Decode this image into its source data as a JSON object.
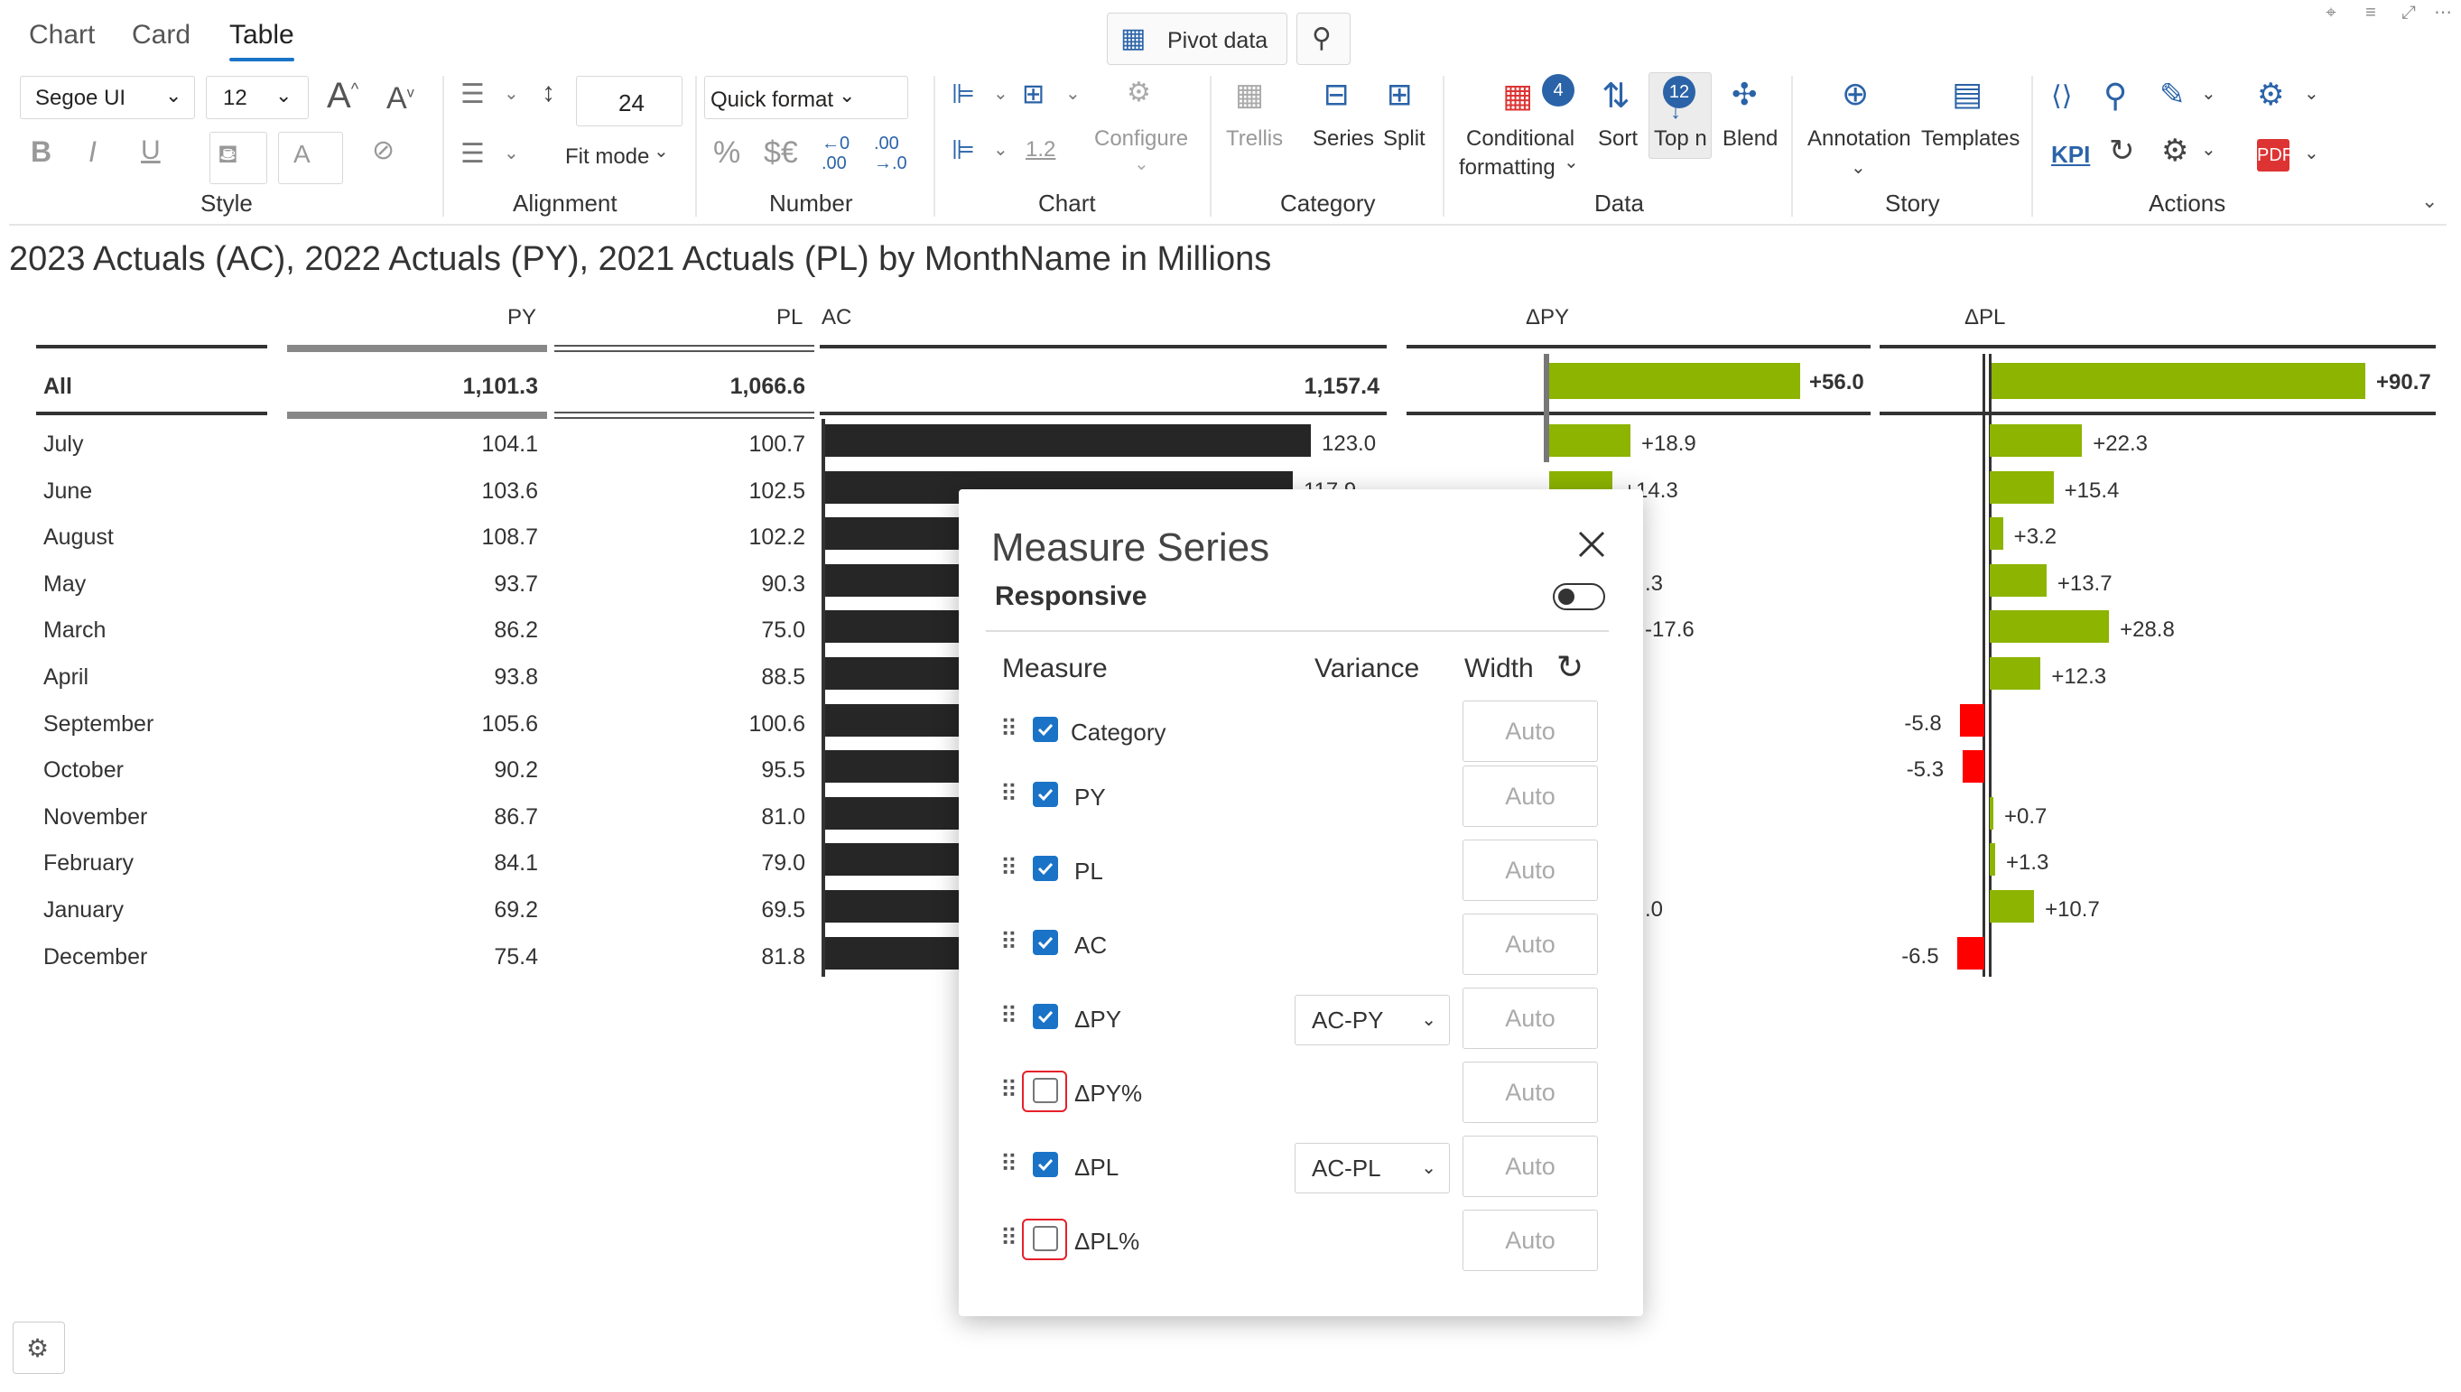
{
  "tabs": [
    "Chart",
    "Card",
    "Table"
  ],
  "toolbar": {
    "pivot_data": "Pivot data"
  },
  "ribbon": {
    "style": {
      "font": "Segoe UI",
      "size": "12",
      "label": "Style"
    },
    "alignment": {
      "line_height": "24",
      "fit_mode": "Fit mode",
      "label": "Alignment"
    },
    "number": {
      "quick_format": "Quick format",
      "percent": "%",
      "currency": "$€",
      "dec_left": "←0",
      "dec_left2": ".00",
      "dec_right": ".00",
      "dec_right2": "→.0",
      "label": "Number"
    },
    "chart": {
      "configure": "Configure",
      "scale": "1.2",
      "label": "Chart"
    },
    "category": {
      "trellis": "Trellis",
      "series": "Series",
      "split": "Split",
      "label": "Category"
    },
    "data": {
      "conditional": "Conditional",
      "formatting": "formatting",
      "conditional_badge": "4",
      "sort": "Sort",
      "topn": "Top n",
      "topn_badge": "12",
      "blend": "Blend",
      "label": "Data"
    },
    "story": {
      "annotation": "Annotation",
      "templates": "Templates",
      "label": "Story"
    },
    "actions": {
      "kpi": "KPI",
      "label": "Actions"
    }
  },
  "title": "2023 Actuals (AC), 2022 Actuals (PY), 2021 Actuals (PL) by MonthName in Millions",
  "table": {
    "headers": {
      "py": "PY",
      "pl": "PL",
      "ac": "AC",
      "dpy": "ΔPY",
      "dpl": "ΔPL"
    },
    "total": {
      "label": "All",
      "py": "1,101.3",
      "pl": "1,066.6",
      "ac": "1,157.4",
      "dpy": "+56.0",
      "dpl": "+90.7"
    },
    "rows": [
      {
        "label": "July",
        "py": "104.1",
        "pl": "100.7",
        "ac": "123.0",
        "dpy": "+18.9",
        "dpl": "+22.3"
      },
      {
        "label": "June",
        "py": "103.6",
        "pl": "102.5",
        "ac": "117.9",
        "dpy": "+14.3",
        "dpl": "+15.4"
      },
      {
        "label": "August",
        "py": "108.7",
        "pl": "102.2",
        "ac": "",
        "dpy": "",
        "dpl": "+3.2"
      },
      {
        "label": "May",
        "py": "93.7",
        "pl": "90.3",
        "ac": "",
        "dpy": ".3",
        "dpl": "+13.7"
      },
      {
        "label": "March",
        "py": "86.2",
        "pl": "75.0",
        "ac": "",
        "dpy": "-17.6",
        "dpl": "+28.8"
      },
      {
        "label": "April",
        "py": "93.8",
        "pl": "88.5",
        "ac": "",
        "dpy": "",
        "dpl": "+12.3"
      },
      {
        "label": "September",
        "py": "105.6",
        "pl": "100.6",
        "ac": "",
        "dpy": "",
        "dpl": "-5.8"
      },
      {
        "label": "October",
        "py": "90.2",
        "pl": "95.5",
        "ac": "",
        "dpy": "",
        "dpl": "-5.3"
      },
      {
        "label": "November",
        "py": "86.7",
        "pl": "81.0",
        "ac": "",
        "dpy": "",
        "dpl": "+0.7"
      },
      {
        "label": "February",
        "py": "84.1",
        "pl": "79.0",
        "ac": "",
        "dpy": "",
        "dpl": "+1.3"
      },
      {
        "label": "January",
        "py": "69.2",
        "pl": "69.5",
        "ac": "",
        "dpy": ".0",
        "dpl": "+10.7"
      },
      {
        "label": "December",
        "py": "75.4",
        "pl": "81.8",
        "ac": "",
        "dpy": "",
        "dpl": "-6.5"
      }
    ]
  },
  "chart_data": {
    "type": "bar",
    "categories": [
      "July",
      "June",
      "August",
      "May",
      "March",
      "April",
      "September",
      "October",
      "November",
      "February",
      "January",
      "December"
    ],
    "series": [
      {
        "name": "PY",
        "values": [
          104.1,
          103.6,
          108.7,
          93.7,
          86.2,
          93.8,
          105.6,
          90.2,
          86.7,
          84.1,
          69.2,
          75.4
        ]
      },
      {
        "name": "PL",
        "values": [
          100.7,
          102.5,
          102.2,
          90.3,
          75.0,
          88.5,
          100.6,
          95.5,
          81.0,
          79.0,
          69.5,
          81.8
        ]
      },
      {
        "name": "ΔPL",
        "values": [
          22.3,
          15.4,
          3.2,
          13.7,
          28.8,
          12.3,
          -5.8,
          -5.3,
          0.7,
          1.3,
          10.7,
          -6.5
        ]
      }
    ],
    "ac_values_visible": [
      123.0,
      117.9
    ],
    "totals": {
      "PY": 1101.3,
      "PL": 1066.6,
      "AC": 1157.4,
      "ΔPY": 56.0,
      "ΔPL": 90.7
    },
    "colors": {
      "ac": "#262626",
      "positive": "#8cb400",
      "negative": "#ff0000"
    }
  },
  "modal": {
    "title": "Measure Series",
    "responsive_label": "Responsive",
    "responsive_on": false,
    "col_measure": "Measure",
    "col_variance": "Variance",
    "col_width": "Width",
    "rows": [
      {
        "name": "Category",
        "checked": true,
        "variance": "",
        "width": "Auto"
      },
      {
        "name": "PY",
        "checked": true,
        "variance": "",
        "width": "Auto"
      },
      {
        "name": "PL",
        "checked": true,
        "variance": "",
        "width": "Auto"
      },
      {
        "name": "AC",
        "checked": true,
        "variance": "",
        "width": "Auto"
      },
      {
        "name": "ΔPY",
        "checked": true,
        "variance": "AC-PY",
        "width": "Auto"
      },
      {
        "name": "ΔPY%",
        "checked": false,
        "variance": "",
        "width": "Auto"
      },
      {
        "name": "ΔPL",
        "checked": true,
        "variance": "AC-PL",
        "width": "Auto"
      },
      {
        "name": "ΔPL%",
        "checked": false,
        "variance": "",
        "width": "Auto"
      }
    ]
  }
}
